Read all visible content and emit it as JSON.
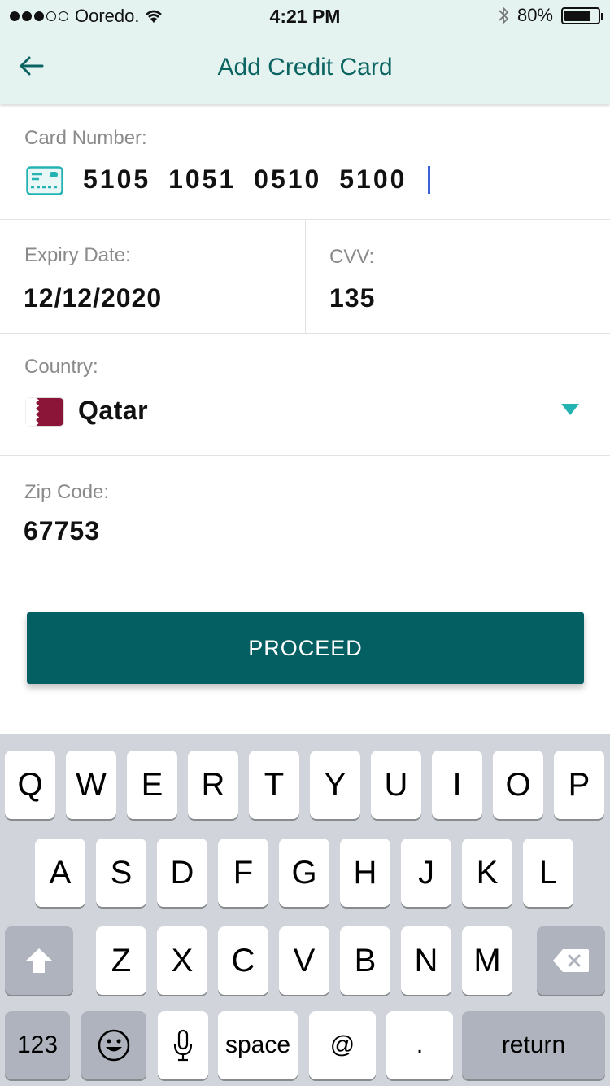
{
  "status_bar": {
    "carrier": "Ooredo.",
    "time": "4:21 PM",
    "battery": "80%",
    "battery_level": 0.8,
    "icons": [
      "signal-dots-icon",
      "wifi-icon",
      "bluetooth-icon",
      "battery-icon"
    ]
  },
  "nav": {
    "title": "Add Credit Card",
    "back_icon": "back-arrow-icon"
  },
  "form": {
    "card_number": {
      "label": "Card Number:",
      "value": "5105 1051 0510 5100",
      "icon": "credit-card-icon"
    },
    "expiry": {
      "label": "Expiry Date:",
      "value": "12/12/2020"
    },
    "cvv": {
      "label": "CVV:",
      "value": "135"
    },
    "country": {
      "label": "Country:",
      "value": "Qatar",
      "flag_icon": "qatar-flag-icon",
      "dropdown_icon": "triangle-down-icon"
    },
    "zip": {
      "label": "Zip Code:",
      "value": "67753"
    }
  },
  "proceed_label": "PROCEED",
  "colors": {
    "header_bg": "#e4f3f0",
    "accent": "#0b6461",
    "button": "#045f63",
    "dropdown": "#23b3b3",
    "cursor": "#3a62d6"
  },
  "keyboard": {
    "row1": [
      "Q",
      "W",
      "E",
      "R",
      "T",
      "Y",
      "U",
      "I",
      "O",
      "P"
    ],
    "row2": [
      "A",
      "S",
      "D",
      "F",
      "G",
      "H",
      "J",
      "K",
      "L"
    ],
    "row3": [
      "Z",
      "X",
      "C",
      "V",
      "B",
      "N",
      "M"
    ],
    "numbers_label": "123",
    "space_label": "space",
    "at_label": "@",
    "period_label": ".",
    "return_label": "return",
    "icons": [
      "shift-icon",
      "delete-icon",
      "emoji-icon",
      "microphone-icon"
    ]
  }
}
